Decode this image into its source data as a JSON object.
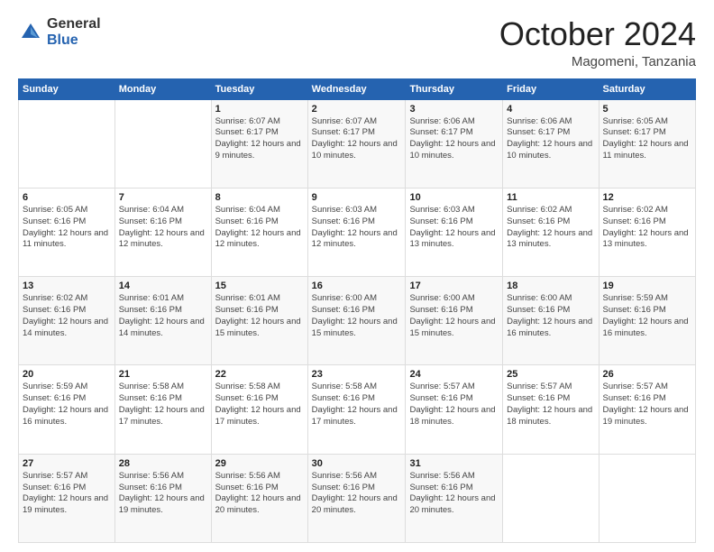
{
  "header": {
    "logo_general": "General",
    "logo_blue": "Blue",
    "month_title": "October 2024",
    "location": "Magomeni, Tanzania"
  },
  "weekdays": [
    "Sunday",
    "Monday",
    "Tuesday",
    "Wednesday",
    "Thursday",
    "Friday",
    "Saturday"
  ],
  "weeks": [
    [
      {
        "day": "",
        "info": ""
      },
      {
        "day": "",
        "info": ""
      },
      {
        "day": "1",
        "info": "Sunrise: 6:07 AM\nSunset: 6:17 PM\nDaylight: 12 hours and 9 minutes."
      },
      {
        "day": "2",
        "info": "Sunrise: 6:07 AM\nSunset: 6:17 PM\nDaylight: 12 hours and 10 minutes."
      },
      {
        "day": "3",
        "info": "Sunrise: 6:06 AM\nSunset: 6:17 PM\nDaylight: 12 hours and 10 minutes."
      },
      {
        "day": "4",
        "info": "Sunrise: 6:06 AM\nSunset: 6:17 PM\nDaylight: 12 hours and 10 minutes."
      },
      {
        "day": "5",
        "info": "Sunrise: 6:05 AM\nSunset: 6:17 PM\nDaylight: 12 hours and 11 minutes."
      }
    ],
    [
      {
        "day": "6",
        "info": "Sunrise: 6:05 AM\nSunset: 6:16 PM\nDaylight: 12 hours and 11 minutes."
      },
      {
        "day": "7",
        "info": "Sunrise: 6:04 AM\nSunset: 6:16 PM\nDaylight: 12 hours and 12 minutes."
      },
      {
        "day": "8",
        "info": "Sunrise: 6:04 AM\nSunset: 6:16 PM\nDaylight: 12 hours and 12 minutes."
      },
      {
        "day": "9",
        "info": "Sunrise: 6:03 AM\nSunset: 6:16 PM\nDaylight: 12 hours and 12 minutes."
      },
      {
        "day": "10",
        "info": "Sunrise: 6:03 AM\nSunset: 6:16 PM\nDaylight: 12 hours and 13 minutes."
      },
      {
        "day": "11",
        "info": "Sunrise: 6:02 AM\nSunset: 6:16 PM\nDaylight: 12 hours and 13 minutes."
      },
      {
        "day": "12",
        "info": "Sunrise: 6:02 AM\nSunset: 6:16 PM\nDaylight: 12 hours and 13 minutes."
      }
    ],
    [
      {
        "day": "13",
        "info": "Sunrise: 6:02 AM\nSunset: 6:16 PM\nDaylight: 12 hours and 14 minutes."
      },
      {
        "day": "14",
        "info": "Sunrise: 6:01 AM\nSunset: 6:16 PM\nDaylight: 12 hours and 14 minutes."
      },
      {
        "day": "15",
        "info": "Sunrise: 6:01 AM\nSunset: 6:16 PM\nDaylight: 12 hours and 15 minutes."
      },
      {
        "day": "16",
        "info": "Sunrise: 6:00 AM\nSunset: 6:16 PM\nDaylight: 12 hours and 15 minutes."
      },
      {
        "day": "17",
        "info": "Sunrise: 6:00 AM\nSunset: 6:16 PM\nDaylight: 12 hours and 15 minutes."
      },
      {
        "day": "18",
        "info": "Sunrise: 6:00 AM\nSunset: 6:16 PM\nDaylight: 12 hours and 16 minutes."
      },
      {
        "day": "19",
        "info": "Sunrise: 5:59 AM\nSunset: 6:16 PM\nDaylight: 12 hours and 16 minutes."
      }
    ],
    [
      {
        "day": "20",
        "info": "Sunrise: 5:59 AM\nSunset: 6:16 PM\nDaylight: 12 hours and 16 minutes."
      },
      {
        "day": "21",
        "info": "Sunrise: 5:58 AM\nSunset: 6:16 PM\nDaylight: 12 hours and 17 minutes."
      },
      {
        "day": "22",
        "info": "Sunrise: 5:58 AM\nSunset: 6:16 PM\nDaylight: 12 hours and 17 minutes."
      },
      {
        "day": "23",
        "info": "Sunrise: 5:58 AM\nSunset: 6:16 PM\nDaylight: 12 hours and 17 minutes."
      },
      {
        "day": "24",
        "info": "Sunrise: 5:57 AM\nSunset: 6:16 PM\nDaylight: 12 hours and 18 minutes."
      },
      {
        "day": "25",
        "info": "Sunrise: 5:57 AM\nSunset: 6:16 PM\nDaylight: 12 hours and 18 minutes."
      },
      {
        "day": "26",
        "info": "Sunrise: 5:57 AM\nSunset: 6:16 PM\nDaylight: 12 hours and 19 minutes."
      }
    ],
    [
      {
        "day": "27",
        "info": "Sunrise: 5:57 AM\nSunset: 6:16 PM\nDaylight: 12 hours and 19 minutes."
      },
      {
        "day": "28",
        "info": "Sunrise: 5:56 AM\nSunset: 6:16 PM\nDaylight: 12 hours and 19 minutes."
      },
      {
        "day": "29",
        "info": "Sunrise: 5:56 AM\nSunset: 6:16 PM\nDaylight: 12 hours and 20 minutes."
      },
      {
        "day": "30",
        "info": "Sunrise: 5:56 AM\nSunset: 6:16 PM\nDaylight: 12 hours and 20 minutes."
      },
      {
        "day": "31",
        "info": "Sunrise: 5:56 AM\nSunset: 6:16 PM\nDaylight: 12 hours and 20 minutes."
      },
      {
        "day": "",
        "info": ""
      },
      {
        "day": "",
        "info": ""
      }
    ]
  ]
}
